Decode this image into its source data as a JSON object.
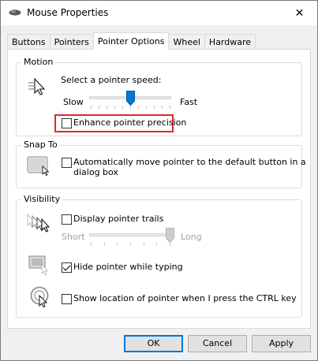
{
  "window": {
    "title": "Mouse Properties",
    "close_glyph": "✕"
  },
  "tabs": [
    {
      "label": "Buttons"
    },
    {
      "label": "Pointers"
    },
    {
      "label": "Pointer Options"
    },
    {
      "label": "Wheel"
    },
    {
      "label": "Hardware"
    }
  ],
  "active_tab": "Pointer Options",
  "motion": {
    "group_label": "Motion",
    "speed_label": "Select a pointer speed:",
    "slow_label": "Slow",
    "fast_label": "Fast",
    "speed_value": 0.5,
    "enhance_label": "Enhance pointer precision",
    "enhance_checked": false,
    "highlight_color": "#e2262e"
  },
  "snap_to": {
    "group_label": "Snap To",
    "auto_move_label_line1": "Automatically move pointer to the default button in a",
    "auto_move_label_line2": "dialog box",
    "auto_move_checked": false
  },
  "visibility": {
    "group_label": "Visibility",
    "trails_label": "Display pointer trails",
    "trails_checked": false,
    "short_label": "Short",
    "long_label": "Long",
    "trails_value": 1.0,
    "hide_label": "Hide pointer while typing",
    "hide_checked": true,
    "show_location_label": "Show location of pointer when I press the CTRL key",
    "show_location_checked": false
  },
  "buttons": {
    "ok": "OK",
    "cancel": "Cancel",
    "apply": "Apply"
  },
  "colors": {
    "accent": "#0078d7",
    "thumb": "#0078d7"
  }
}
